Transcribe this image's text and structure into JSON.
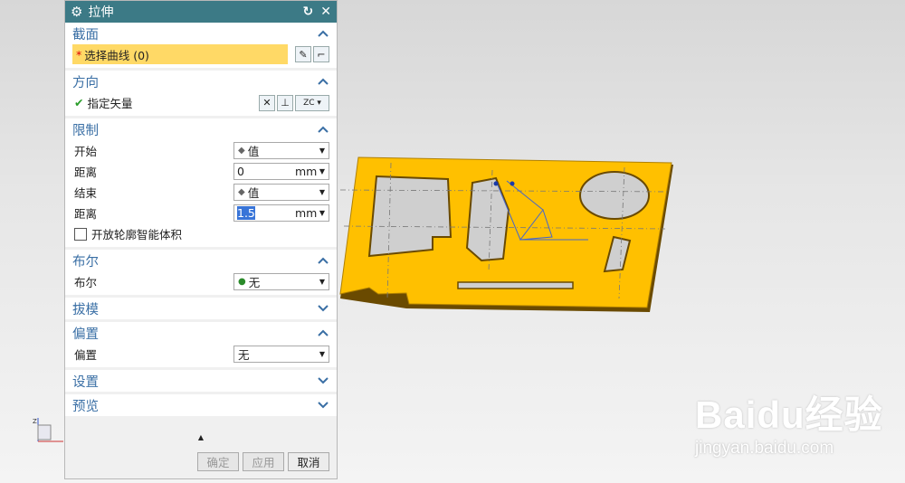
{
  "dialog": {
    "title": "拉伸",
    "sections": {
      "section": {
        "label": "截面",
        "select_label": "选择曲线 (0)",
        "required": "*"
      },
      "direction": {
        "label": "方向",
        "vector_label": "指定矢量",
        "vector_btn": "ZC"
      },
      "limits": {
        "label": "限制",
        "start_label": "开始",
        "start_value": "值",
        "start_dist_label": "距离",
        "start_dist_value": "0",
        "start_unit": "mm",
        "end_label": "结束",
        "end_value": "值",
        "end_dist_label": "距离",
        "end_dist_value": "1.5",
        "end_unit": "mm",
        "open_profile_label": "开放轮廓智能体积"
      },
      "boolean": {
        "label": "布尔",
        "field_label": "布尔",
        "value": "无"
      },
      "draft": {
        "label": "拔模"
      },
      "offset": {
        "label": "偏置",
        "field_label": "偏置",
        "value": "无"
      },
      "settings": {
        "label": "设置"
      },
      "preview": {
        "label": "预览"
      }
    },
    "buttons": {
      "ok": "确定",
      "apply": "应用",
      "cancel": "取消"
    }
  },
  "watermark": {
    "brand": "Baidu经验",
    "url": "jingyan.baidu.com"
  },
  "colors": {
    "title_bar": "#3c7a86",
    "section_header": "#3a6fa5",
    "selection_highlight": "#ffd966",
    "part_face": "#ffc000"
  }
}
